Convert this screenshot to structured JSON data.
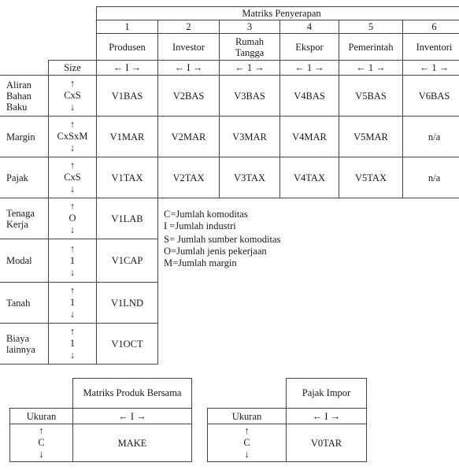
{
  "absorption_matrix": {
    "title": "Matriks Penyerapan",
    "size_header": "Size",
    "columns": [
      {
        "number": "1",
        "label": "Produsen",
        "size": "← I →"
      },
      {
        "number": "2",
        "label": "Investor",
        "size": "← I →"
      },
      {
        "number": "3",
        "label": "Rumah Tangga",
        "size": "← 1 →"
      },
      {
        "number": "4",
        "label": "Ekspor",
        "size": "← 1 →"
      },
      {
        "number": "5",
        "label": "Pemerintah",
        "size": "← 1 →"
      },
      {
        "number": "6",
        "label": "Inventori",
        "size": "← 1 →"
      }
    ],
    "rows": [
      {
        "label": "Aliran Bahan Baku",
        "size": "CxS",
        "cells": [
          "V1BAS",
          "V2BAS",
          "V3BAS",
          "V4BAS",
          "V5BAS",
          "V6BAS"
        ]
      },
      {
        "label": "Margin",
        "size": "CxSxM",
        "cells": [
          "V1MAR",
          "V2MAR",
          "V3MAR",
          "V4MAR",
          "V5MAR",
          "n/a"
        ]
      },
      {
        "label": "Pajak",
        "size": "CxS",
        "cells": [
          "V1TAX",
          "V2TAX",
          "V3TAX",
          "V4TAX",
          "V5TAX",
          "n/a"
        ]
      },
      {
        "label": "Tenaga Kerja",
        "size": "O",
        "cells": [
          "V1LAB"
        ]
      },
      {
        "label": "Modal",
        "size": "1",
        "cells": [
          "V1CAP"
        ]
      },
      {
        "label": "Tanah",
        "size": "1",
        "cells": [
          "V1LND"
        ]
      },
      {
        "label": "Biaya lainnya",
        "size": "1",
        "cells": [
          "V1OCT"
        ]
      }
    ],
    "arrow_up": "↑",
    "arrow_down": "↓"
  },
  "legend": [
    "C=Jumlah komoditas",
    "I =Jumlah industri",
    "S= Jumlah sumber komoditas",
    "O=Jumlah jenis pekerjaan",
    "M=Jumlah margin"
  ],
  "make_matrix": {
    "title": "Matriks Produk Bersama",
    "size_header": "Ukuran",
    "col_size": "←  I  →",
    "row_size": "C",
    "cell": "MAKE"
  },
  "import_tax": {
    "title": "Pajak Impor",
    "size_header": "Ukuran",
    "col_size": "←  I  →",
    "row_size": "C",
    "cell": "V0TAR"
  }
}
